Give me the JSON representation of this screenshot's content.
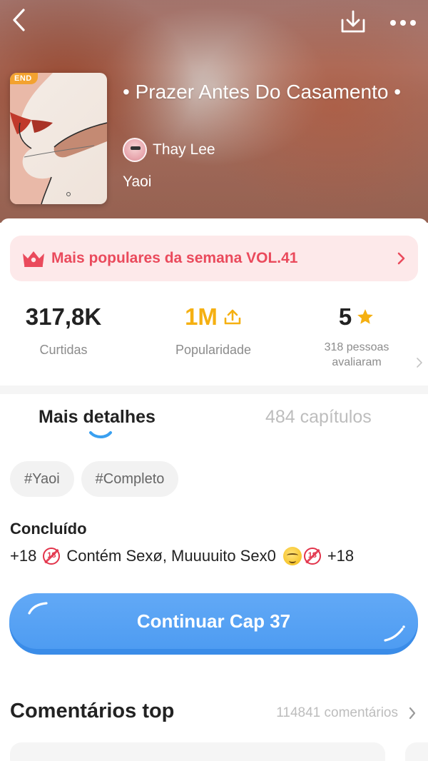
{
  "header": {
    "cover_badge": "END",
    "title": "• Prazer Antes Do Casamento •",
    "author": "Thay Lee",
    "genre": "Yaoi",
    "icons": {
      "back": "chevron-left-icon",
      "download": "download-icon",
      "more": "more-dots-icon"
    }
  },
  "ranking": {
    "label": "Mais populares da semana VOL.41",
    "icon": "crown-icon",
    "color": "#ea4a5c",
    "background": "#fde9ea"
  },
  "stats": {
    "likes": {
      "value": "317,8K",
      "label": "Curtidas"
    },
    "popularity": {
      "value": "1M",
      "label": "Popularidade",
      "color": "#f5b011"
    },
    "rating": {
      "value": "5",
      "label_line1": "318 pessoas",
      "label_line2": "avaliaram"
    }
  },
  "tabs": {
    "details": "Mais detalhes",
    "chapters": "484 capítulos"
  },
  "tags": [
    "#Yaoi",
    "#Completo"
  ],
  "details": {
    "status": "Concluído",
    "description_parts": {
      "p1": "+18",
      "p2": "Contém Sexø, Muuuuito Sex0",
      "p3": "+18",
      "badge": "18"
    }
  },
  "cta": {
    "label": "Continuar Cap 37",
    "color": "#4e9cf2"
  },
  "comments": {
    "title": "Comentários top",
    "count": "114841 comentários"
  }
}
